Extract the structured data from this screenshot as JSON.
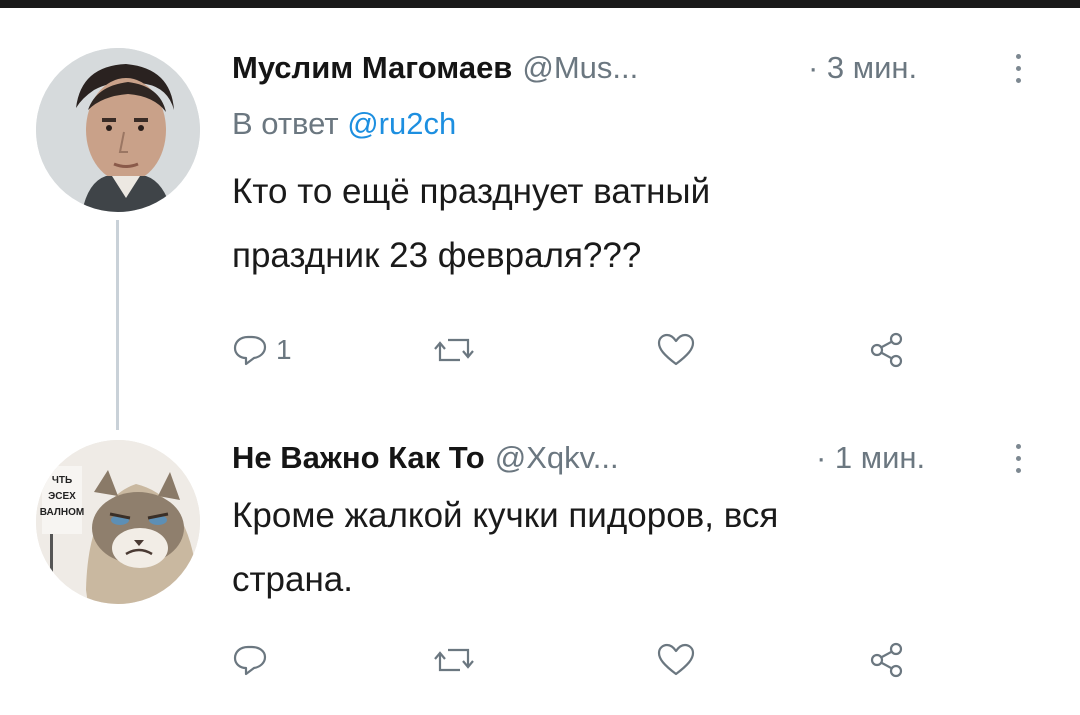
{
  "tweets": [
    {
      "name": "Муслим Магомаев",
      "handle": "@Mus...",
      "time": "· 3 мин.",
      "reply_prefix": "В ответ",
      "reply_mention": "@ru2ch",
      "text_line1": "Кто то ещё празднует ватный",
      "text_line2": "праздник 23 февраля???",
      "reply_count": "1",
      "avatar": "man-portrait",
      "icons": [
        "reply-icon",
        "retweet-icon",
        "like-icon",
        "share-icon",
        "more-icon"
      ]
    },
    {
      "name": "Не Важно Как То",
      "handle": "@Xqkv...",
      "time": "· 1 мин.",
      "text_line1": "Кроме жалкой кучки пидоров, вся",
      "text_line2": "страна.",
      "avatar": "grumpy-cat-with-sign",
      "avatar_sign_lines": [
        "ЧТЬ",
        "ЭСЕХ",
        "ВАЛНОМ"
      ],
      "icons": [
        "reply-icon",
        "retweet-icon",
        "like-icon",
        "share-icon",
        "more-icon"
      ]
    }
  ],
  "colors": {
    "text": "#1a1a1a",
    "muted": "#6b7780",
    "mention": "#1d8fe0",
    "thread_line": "#c9d1d8",
    "top_bar": "#1a1a1a"
  }
}
